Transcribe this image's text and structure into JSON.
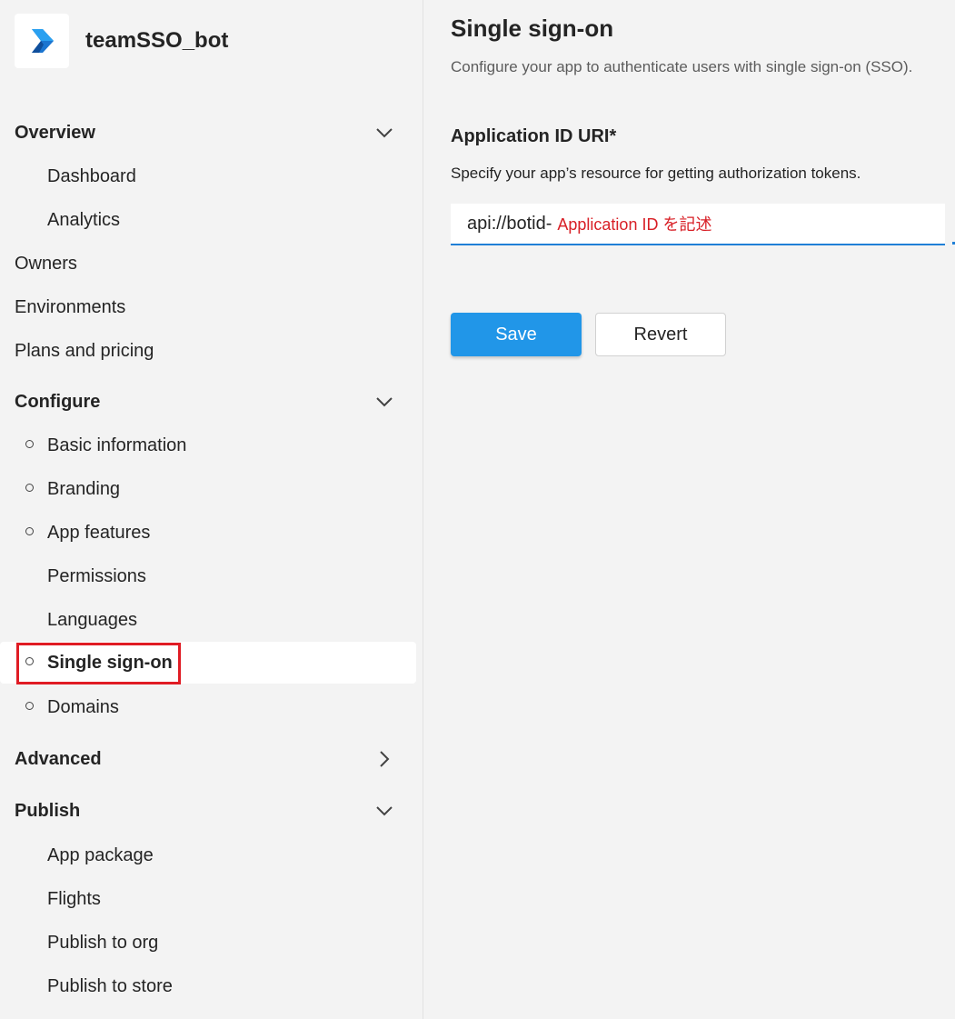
{
  "app": {
    "name": "teamSSO_bot",
    "logo": "teams-dev-portal-logo"
  },
  "sidebar": {
    "overview": {
      "label": "Overview",
      "chevron": "chevron-down-icon",
      "items": [
        {
          "label": "Dashboard",
          "status": "none"
        },
        {
          "label": "Analytics",
          "status": "none"
        }
      ]
    },
    "top_items": [
      {
        "label": "Owners"
      },
      {
        "label": "Environments"
      },
      {
        "label": "Plans and pricing"
      }
    ],
    "configure": {
      "label": "Configure",
      "chevron": "chevron-down-icon",
      "items": [
        {
          "label": "Basic information",
          "status": "circle"
        },
        {
          "label": "Branding",
          "status": "circle"
        },
        {
          "label": "App features",
          "status": "circle"
        },
        {
          "label": "Permissions",
          "status": "none"
        },
        {
          "label": "Languages",
          "status": "none"
        },
        {
          "label": "Single sign-on",
          "status": "circle",
          "selected": true
        },
        {
          "label": "Domains",
          "status": "circle"
        }
      ]
    },
    "advanced": {
      "label": "Advanced",
      "chevron": "chevron-right-icon"
    },
    "publish": {
      "label": "Publish",
      "chevron": "chevron-down-icon",
      "items": [
        {
          "label": "App package"
        },
        {
          "label": "Flights"
        },
        {
          "label": "Publish to org"
        },
        {
          "label": "Publish to store"
        }
      ]
    }
  },
  "main": {
    "title": "Single sign-on",
    "description": "Configure your app to authenticate users with single sign-on (SSO).",
    "field": {
      "label": "Application ID URI*",
      "description": "Specify your app’s resource for getting authorization tokens.",
      "value_prefix": "api://botid-",
      "annotation": "Application ID を記述"
    },
    "buttons": {
      "save": "Save",
      "revert": "Revert"
    }
  },
  "colors": {
    "accent": "#2196e8",
    "annotation_red": "#d81f26",
    "highlight_red": "#e01c24",
    "sidebar_bg": "#f3f3f3"
  }
}
